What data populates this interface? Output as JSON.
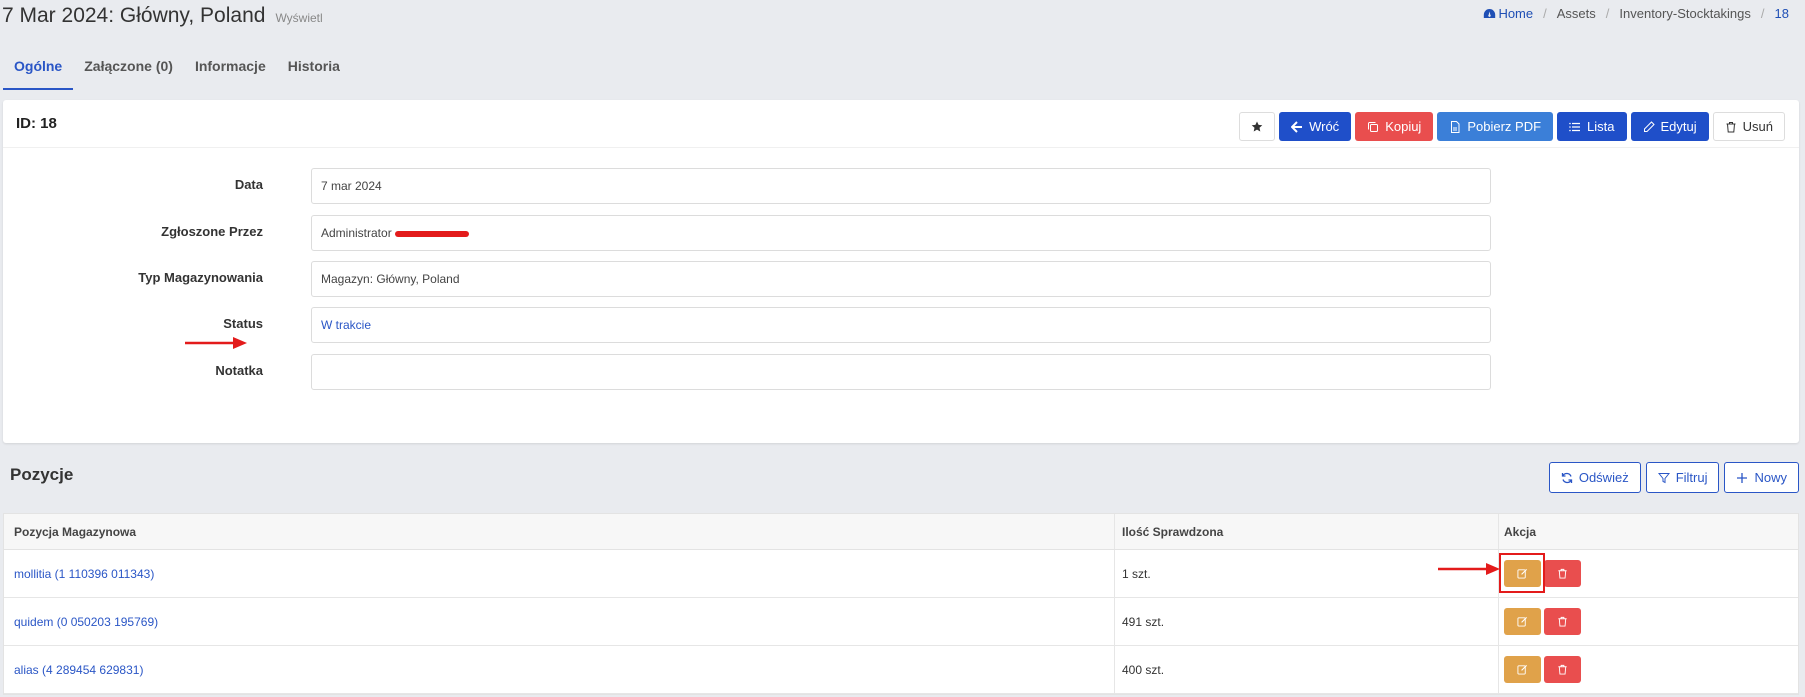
{
  "header": {
    "title": "7 Mar 2024: Główny, Poland",
    "subtitle": "Wyświetl"
  },
  "breadcrumb": {
    "home": "Home",
    "items": [
      "Assets",
      "Inventory-Stocktakings",
      "18"
    ]
  },
  "tabs": [
    {
      "label": "Ogólne",
      "active": true
    },
    {
      "label": "Załączone (0)",
      "active": false
    },
    {
      "label": "Informacje",
      "active": false
    },
    {
      "label": "Historia",
      "active": false
    }
  ],
  "record": {
    "id_label": "ID: 18"
  },
  "toolbar": {
    "back": "Wróć",
    "copy": "Kopiuj",
    "pdf": "Pobierz PDF",
    "list": "Lista",
    "edit": "Edytuj",
    "delete": "Usuń"
  },
  "form": {
    "date": {
      "label": "Data",
      "value": "7 mar 2024"
    },
    "reported_by": {
      "label": "Zgłoszone Przez",
      "value": "Administrator"
    },
    "storage_type": {
      "label": "Typ Magazynowania",
      "value": "Magazyn: Główny, Poland"
    },
    "status": {
      "label": "Status",
      "value": "W trakcie"
    },
    "note": {
      "label": "Notatka",
      "value": ""
    }
  },
  "positions": {
    "title": "Pozycje",
    "refresh": "Odśwież",
    "filter": "Filtruj",
    "new": "Nowy",
    "columns": [
      "Pozycja Magazynowa",
      "Ilość Sprawdzona",
      "Akcja"
    ],
    "rows": [
      {
        "item": "mollitia (1 110396 011343)",
        "qty": "1 szt."
      },
      {
        "item": "quidem (0 050203 195769)",
        "qty": "491 szt."
      },
      {
        "item": "alias (4 289454 629831)",
        "qty": "400 szt."
      }
    ]
  },
  "colors": {
    "primary": "#1f4fc9",
    "danger": "#e94e4e",
    "warning": "#e0a24a",
    "annotation": "#e31b1b"
  }
}
